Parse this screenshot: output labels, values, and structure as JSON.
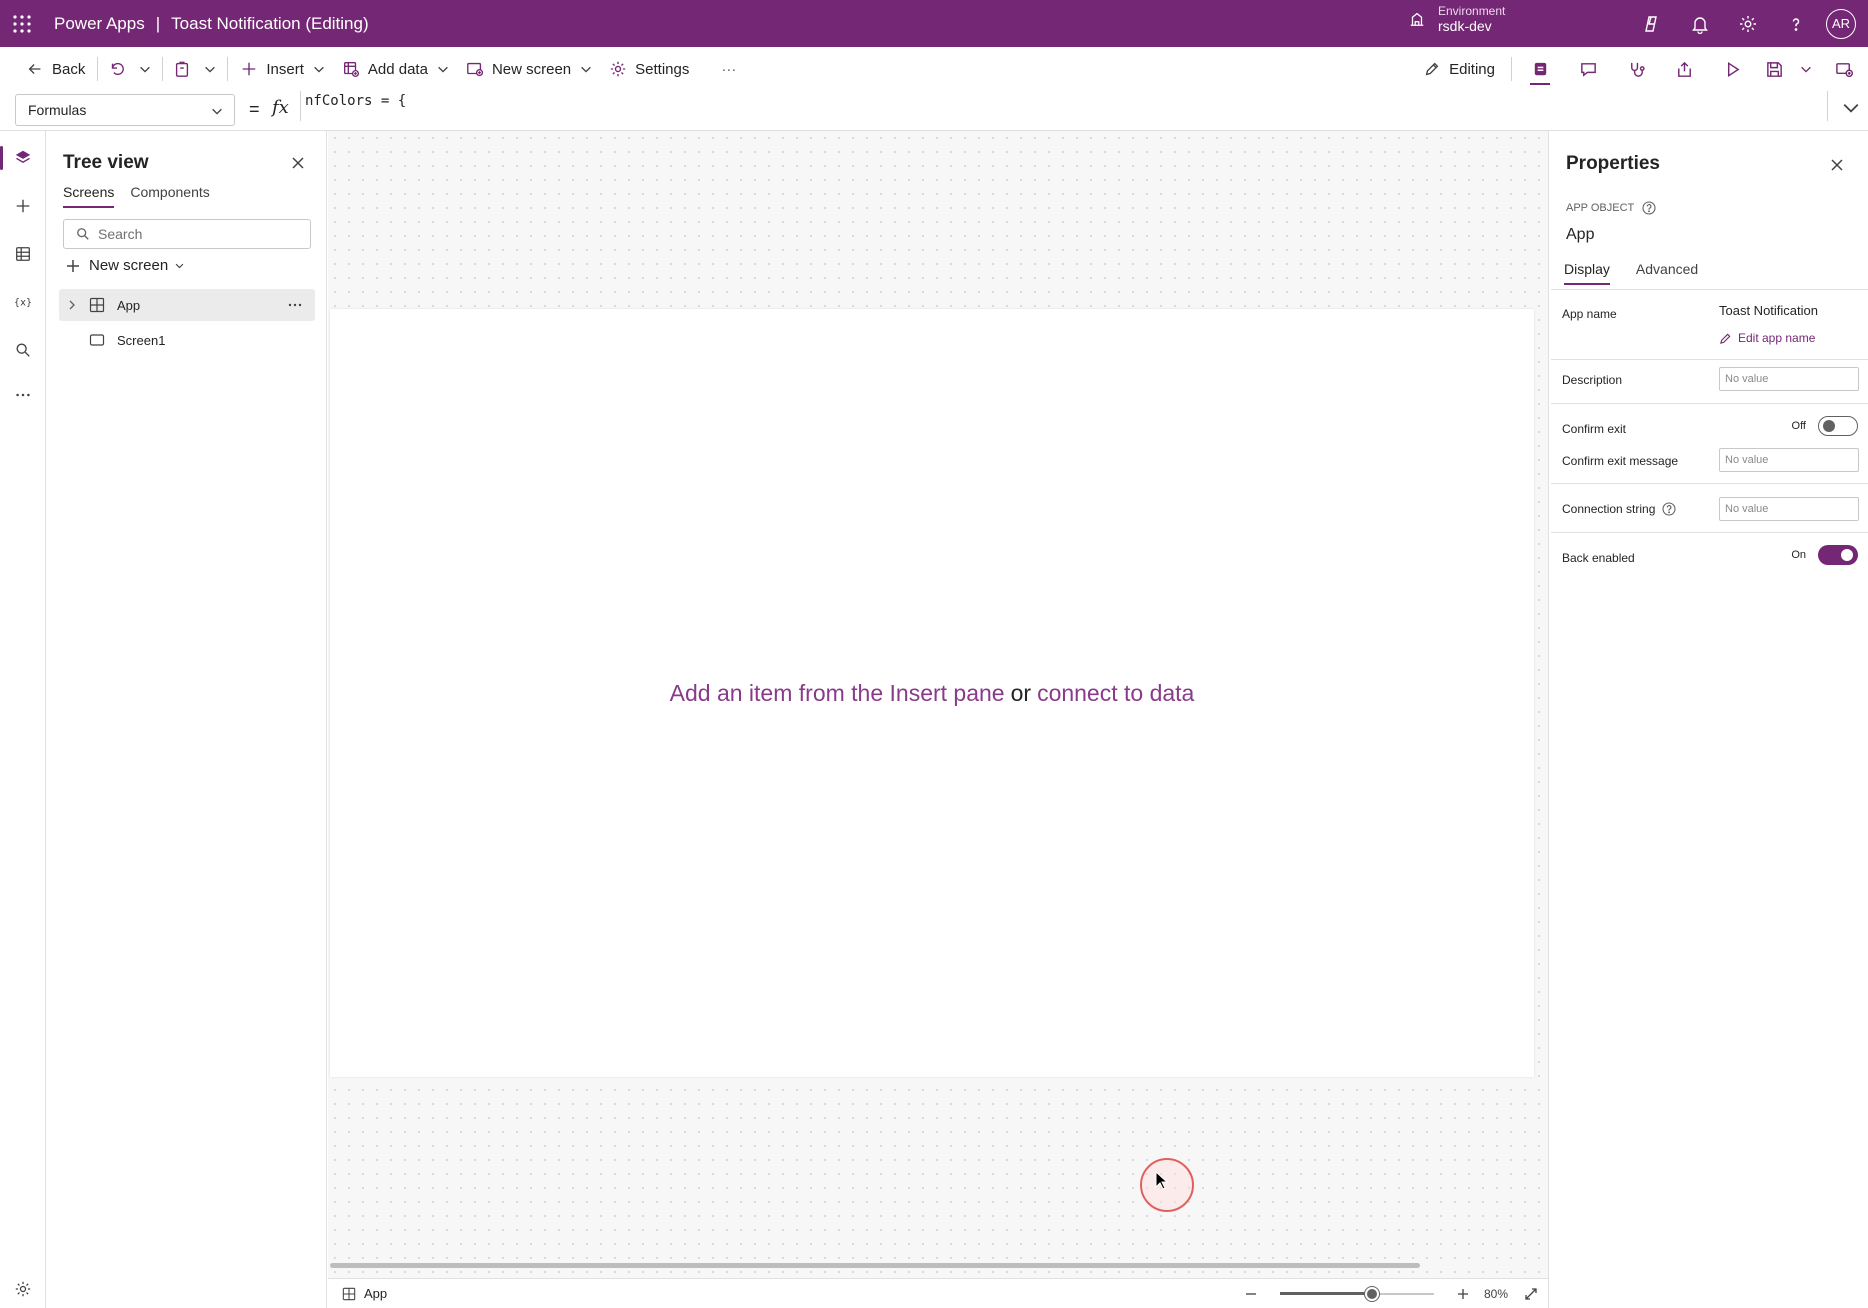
{
  "topbar": {
    "app_name": "Power Apps",
    "separator": "|",
    "doc_title": "Toast Notification (Editing)",
    "environment_label": "Environment",
    "environment_name": "rsdk-dev",
    "avatar_initials": "AR",
    "icons": [
      "waffle-icon",
      "environment-icon",
      "copilot-icon",
      "bell-icon",
      "gear-icon",
      "help-icon"
    ]
  },
  "commandbar": {
    "back": "Back",
    "insert": "Insert",
    "add_data": "Add data",
    "new_screen": "New screen",
    "settings": "Settings",
    "more": "···",
    "editing": "Editing"
  },
  "formulabar": {
    "property": "Formulas",
    "equals": "=",
    "fx": "fx",
    "formula": "nfColors = {"
  },
  "treeview": {
    "title": "Tree view",
    "tabs": [
      "Screens",
      "Components"
    ],
    "search_placeholder": "Search",
    "new_screen": "New screen",
    "items": [
      {
        "label": "App",
        "selected": true
      },
      {
        "label": "Screen1",
        "selected": false
      }
    ]
  },
  "canvas": {
    "hint_link1": "Add an item from the Insert pane",
    "hint_or": "or",
    "hint_link2": "connect to data",
    "footer_app": "App",
    "zoom_value": "80%",
    "zoom_fraction": 0.6
  },
  "properties": {
    "title": "Properties",
    "object_type": "APP OBJECT",
    "object_name": "App",
    "tabs": [
      "Display",
      "Advanced"
    ],
    "app_name_label": "App name",
    "app_name_value": "Toast Notification",
    "edit_app_name": "Edit app name",
    "description_label": "Description",
    "description_placeholder": "No value",
    "confirm_exit_label": "Confirm exit",
    "confirm_exit_state": "Off",
    "confirm_exit_message_label": "Confirm exit message",
    "confirm_exit_message_placeholder": "No value",
    "connection_string_label": "Connection string",
    "connection_string_placeholder": "No value",
    "back_enabled_label": "Back enabled",
    "back_enabled_state": "On"
  },
  "colors": {
    "brand": "#742774",
    "link": "#8a3a8a"
  }
}
